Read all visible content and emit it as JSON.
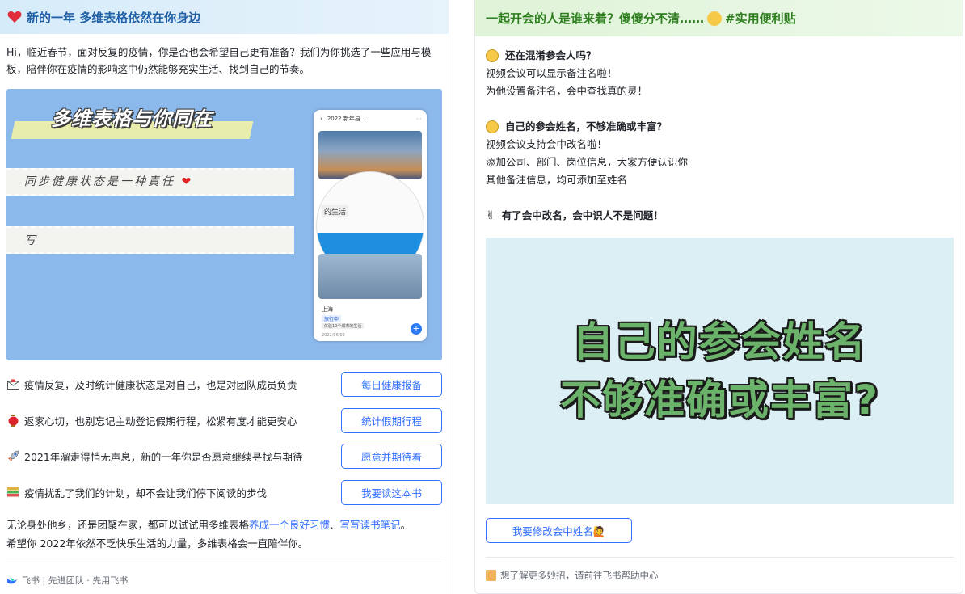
{
  "left": {
    "header_title": "新的一年 多维表格依然在你身边",
    "intro": "Hi，临近春节，面对反复的疫情，你是否也会希望自己更有准备？我们为你挑选了一些应用与模板，陪伴你在疫情的影响这中仍然能够充实生活、找到自己的节奏。",
    "banner": {
      "title": "多维表格与你同在",
      "line1": "同步健康状态是一种責任",
      "line2": "写",
      "phone_title": "2022 新年县...",
      "phone_tag": "的生活",
      "phone_city": "上海",
      "phone_chip1": "旅行中",
      "phone_chip2": "体验10个城市的生活",
      "phone_date": "2022/06/02"
    },
    "rows": [
      {
        "text": "疫情反复，及时统计健康状态是对自己，也是对团队成员负责",
        "button": "每日健康报备",
        "icon": "envelope-icon"
      },
      {
        "text": "返家心切，也别忘记主动登记假期行程，松紧有度才能更安心",
        "button": "统计假期行程",
        "icon": "lantern-icon"
      },
      {
        "text": "2021年溜走得悄无声息，新的一年你是否愿意继续寻找与期待",
        "button": "愿意并期待着",
        "icon": "rocket-icon"
      },
      {
        "text": "疫情扰乱了我们的计划，却不会让我们停下阅读的步伐",
        "button": "我要读这本书",
        "icon": "books-icon"
      }
    ],
    "outro": {
      "p1_a": "无论身处他乡，还是团聚在家，都可以试试用多维表格",
      "p1_link1": "养成一个良好习惯",
      "p1_sep": "、",
      "p1_link2": "写写读书笔记",
      "p1_end": "。",
      "p2": "希望你 2022年依然不乏快乐生活的力量，多维表格会一直陪伴你。"
    },
    "footer": "飞书 | 先进团队 · 先用飞书"
  },
  "right": {
    "header_title": "一起开会的人是谁来着？傻傻分不清……",
    "header_tag": "#实用便利贴",
    "sections": [
      {
        "heading": "还在混淆参会人吗？",
        "lines": [
          "视频会议可以显示备注名啦！",
          "为他设置备注名，会中查找真的灵！"
        ]
      },
      {
        "heading": "自己的参会姓名，不够准确或丰富？",
        "lines": [
          "视频会议支持会中改名啦！",
          "添加公司、部门、岗位信息，大家方便认识你",
          "其他备注信息，均可添加至姓名"
        ]
      },
      {
        "heading": "有了会中改名，会中识人不是问题！",
        "lines": []
      }
    ],
    "image_text1": "自己的参会姓名",
    "image_text2": "不够准确或丰富?",
    "button": "我要修改会中姓名🙋",
    "footer": "想了解更多妙招，请前往飞书帮助中心"
  }
}
